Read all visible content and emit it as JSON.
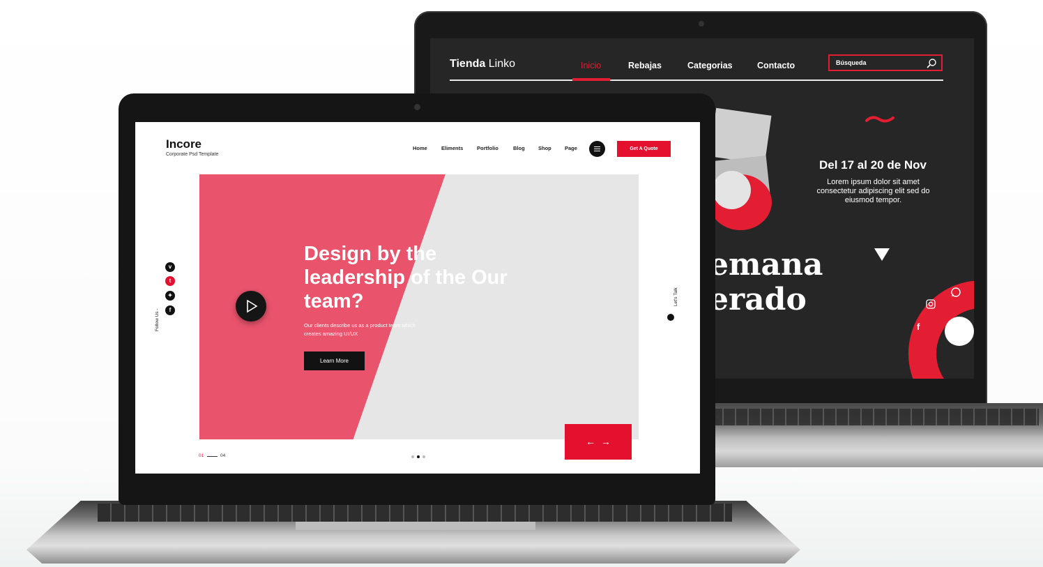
{
  "back_site": {
    "logo_bold": "Tienda",
    "logo_light": "Linko",
    "nav": [
      {
        "label": "Inicio",
        "active": true
      },
      {
        "label": "Rebajas",
        "active": false
      },
      {
        "label": "Categorias",
        "active": false
      },
      {
        "label": "Contacto",
        "active": false
      }
    ],
    "search_placeholder": "Búsqueda",
    "date_heading": "Del 17 al 20 de Nov",
    "description": "Lorem ipsum dolor sit amet consectetur adipiscing elit sed do eiusmod tempor.",
    "big_text_line1": "emana",
    "big_text_line2": "erado",
    "accent_color": "#e31e33",
    "social_icons": [
      "whatsapp-icon",
      "instagram-icon",
      "facebook-icon"
    ]
  },
  "front_site": {
    "logo": "Incore",
    "tagline": "Corporate Psd Template",
    "nav": [
      "Home",
      "Eliments",
      "Portfolio",
      "Blog",
      "Shop",
      "Page"
    ],
    "quote_button": "Get A Quote",
    "hero_title": "Design by the leadership of the Our team?",
    "hero_description": "Our clients describe us as a product team which creates amazing UI/UX",
    "learn_more": "Learn More",
    "follow_label": "Follow Us -",
    "lets_talk": "Let's Talk",
    "social": [
      "v",
      "t",
      "tw",
      "f"
    ],
    "page_current": "01",
    "page_total": "04",
    "accent_color": "#e3112d",
    "hero_color": "#e9536c"
  }
}
